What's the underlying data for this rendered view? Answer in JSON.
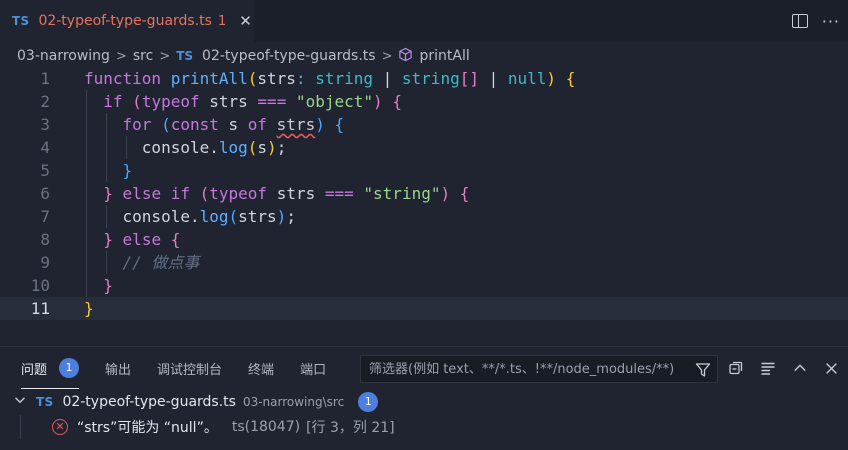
{
  "tab": {
    "lang": "TS",
    "title": "02-typeof-type-guards.ts",
    "problem_count": "1",
    "close": "✕"
  },
  "tab_actions": {
    "split_icon": "split-editor-icon",
    "more": "···"
  },
  "breadcrumb": {
    "folder": "03-narrowing",
    "subfolder": "src",
    "lang": "TS",
    "file": "02-typeof-type-guards.ts",
    "symbol": "printAll",
    "sep": ">"
  },
  "editor": {
    "current_line": 11,
    "line_numbers": [
      "1",
      "2",
      "3",
      "4",
      "5",
      "6",
      "7",
      "8",
      "9",
      "10",
      "11"
    ],
    "lines": [
      [
        [
          "kw",
          "function "
        ],
        [
          "fn",
          "printAll"
        ],
        [
          "p1",
          "("
        ],
        [
          "txt",
          "strs"
        ],
        [
          "ty",
          ": "
        ],
        [
          "ty",
          "string"
        ],
        [
          "txt",
          " | "
        ],
        [
          "ty",
          "string"
        ],
        [
          "p2",
          "[]"
        ],
        [
          "txt",
          " | "
        ],
        [
          "ty",
          "null"
        ],
        [
          "p1",
          ")"
        ],
        [
          "txt",
          " "
        ],
        [
          "p1",
          "{"
        ]
      ],
      [
        [
          "txt",
          "  "
        ],
        [
          "kw",
          "if "
        ],
        [
          "p2",
          "("
        ],
        [
          "kw",
          "typeof "
        ],
        [
          "txt",
          "strs "
        ],
        [
          "kw",
          "==="
        ],
        [
          "txt",
          " "
        ],
        [
          "str",
          "\"object\""
        ],
        [
          "p2",
          ")"
        ],
        [
          "txt",
          " "
        ],
        [
          "p2",
          "{"
        ]
      ],
      [
        [
          "txt",
          "    "
        ],
        [
          "kw",
          "for "
        ],
        [
          "p3",
          "("
        ],
        [
          "kw",
          "const "
        ],
        [
          "txt",
          "s "
        ],
        [
          "kw",
          "of "
        ],
        [
          "err",
          "strs"
        ],
        [
          "p3",
          ")"
        ],
        [
          "txt",
          " "
        ],
        [
          "p3",
          "{"
        ]
      ],
      [
        [
          "txt",
          "      console."
        ],
        [
          "fn",
          "log"
        ],
        [
          "p1",
          "("
        ],
        [
          "txt",
          "s"
        ],
        [
          "p1",
          ")"
        ],
        [
          "txt",
          ";"
        ]
      ],
      [
        [
          "txt",
          "    "
        ],
        [
          "p3",
          "}"
        ]
      ],
      [
        [
          "txt",
          "  "
        ],
        [
          "p2",
          "}"
        ],
        [
          "txt",
          " "
        ],
        [
          "kw",
          "else if "
        ],
        [
          "p2",
          "("
        ],
        [
          "kw",
          "typeof "
        ],
        [
          "txt",
          "strs "
        ],
        [
          "kw",
          "==="
        ],
        [
          "txt",
          " "
        ],
        [
          "str",
          "\"string\""
        ],
        [
          "p2",
          ")"
        ],
        [
          "txt",
          " "
        ],
        [
          "p2",
          "{"
        ]
      ],
      [
        [
          "txt",
          "    console."
        ],
        [
          "fn",
          "log"
        ],
        [
          "p3",
          "("
        ],
        [
          "txt",
          "strs"
        ],
        [
          "p3",
          ")"
        ],
        [
          "txt",
          ";"
        ]
      ],
      [
        [
          "txt",
          "  "
        ],
        [
          "p2",
          "}"
        ],
        [
          "txt",
          " "
        ],
        [
          "kw",
          "else "
        ],
        [
          "p2",
          "{"
        ]
      ],
      [
        [
          "txt",
          "    "
        ],
        [
          "cm",
          "// 做点事"
        ]
      ],
      [
        [
          "txt",
          "  "
        ],
        [
          "p2",
          "}"
        ]
      ],
      [
        [
          "p1",
          "}"
        ]
      ]
    ]
  },
  "panel": {
    "tabs": [
      {
        "label": "问题",
        "active": true,
        "count": "1"
      },
      {
        "label": "输出",
        "active": false
      },
      {
        "label": "调试控制台",
        "active": false
      },
      {
        "label": "终端",
        "active": false
      },
      {
        "label": "端口",
        "active": false
      }
    ],
    "filter_placeholder": "筛选器(例如 text、**/*.ts、!**/node_modules/**)",
    "group": {
      "lang": "TS",
      "file": "02-typeof-type-guards.ts",
      "path": "03-narrowing\\src",
      "count": "1"
    },
    "problem": {
      "message": "“strs”可能为 “null”。",
      "code": "ts(18047)",
      "position": "[行 3，列 21]"
    }
  },
  "colors": {
    "background": "#1f2430",
    "tab_error": "#e8735f",
    "badge": "#4d7fe0",
    "error": "#e45b5b"
  }
}
